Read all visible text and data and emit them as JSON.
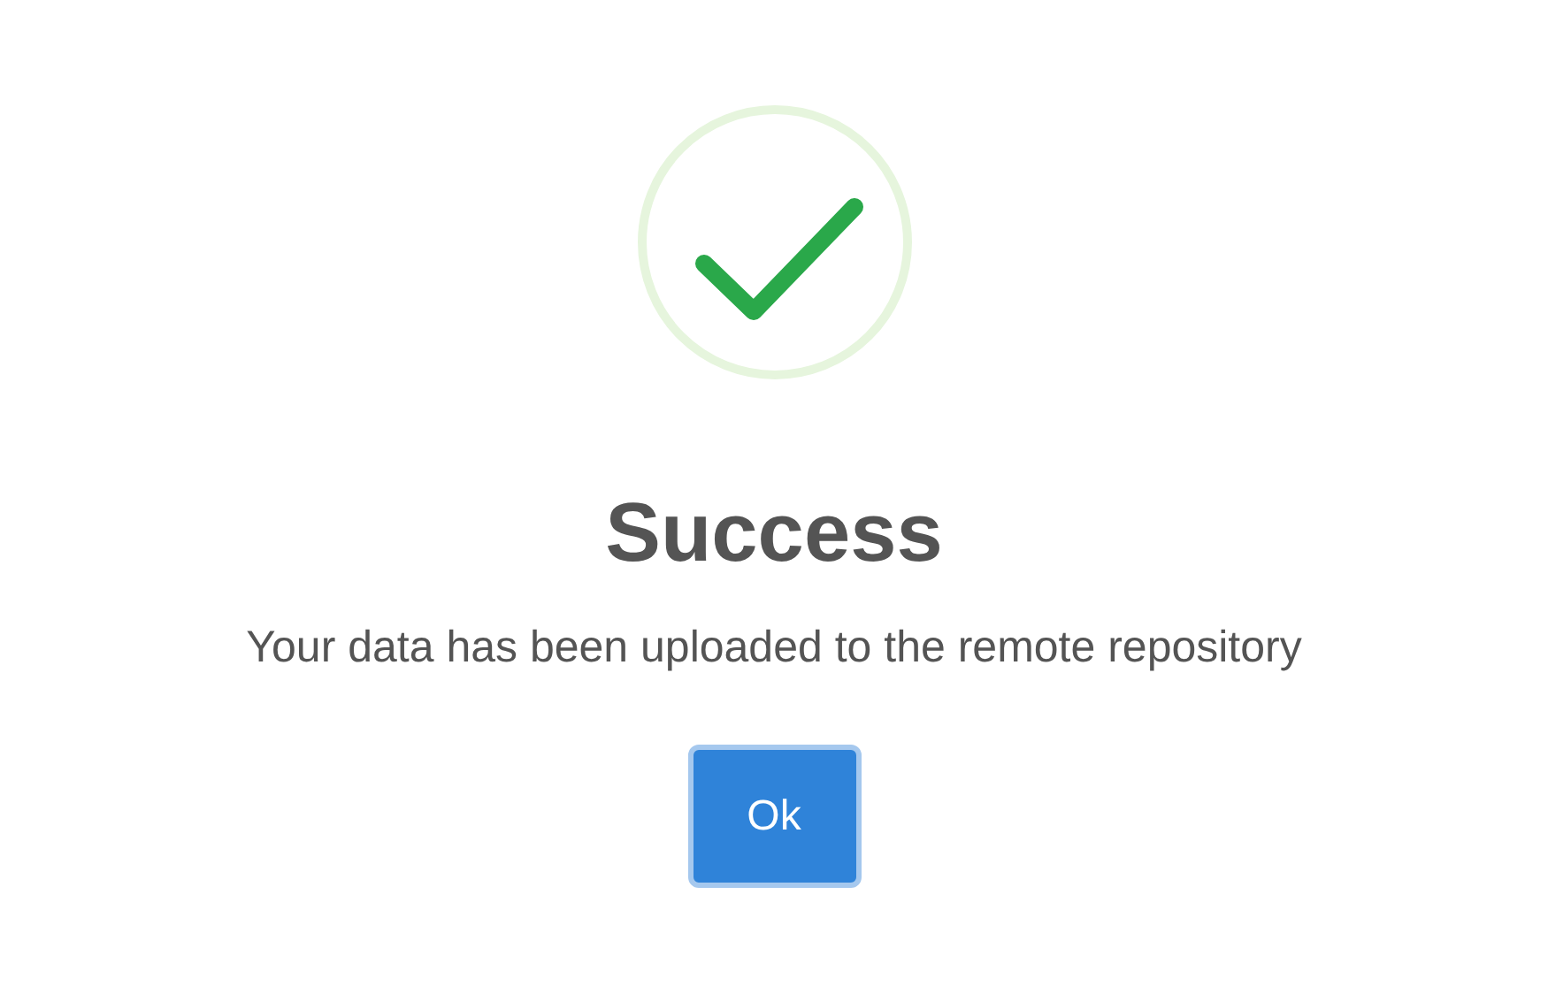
{
  "dialog": {
    "title": "Success",
    "message": "Your data has been uploaded to the remote repository",
    "buttons": [
      {
        "label": "Ok"
      }
    ]
  }
}
